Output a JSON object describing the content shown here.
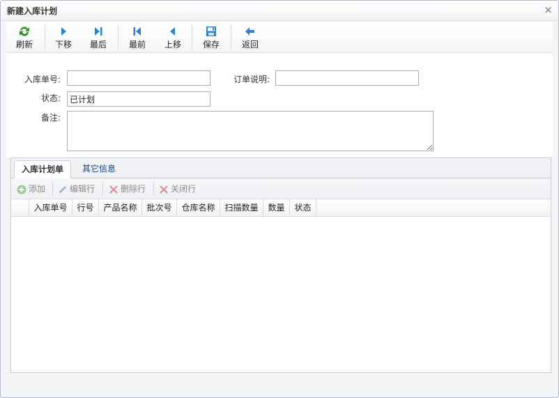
{
  "window": {
    "title": "新建入库计划",
    "close_symbol": "×"
  },
  "toolbar": {
    "refresh": "刷新",
    "next": "下移",
    "last": "最后",
    "first": "最前",
    "prev": "上移",
    "save": "保存",
    "back": "返回"
  },
  "form": {
    "order_no_label": "入库单号:",
    "order_no_value": "",
    "order_desc_label": "订单说明:",
    "order_desc_value": "",
    "status_label": "状态:",
    "status_value": "已计划",
    "remark_label": "备注:",
    "remark_value": ""
  },
  "tabs": [
    {
      "label": "入库计划单",
      "active": true
    },
    {
      "label": "其它信息",
      "active": false
    }
  ],
  "grid_toolbar": {
    "add": "添加",
    "edit": "编辑行",
    "delete": "删除行",
    "close": "关闭行"
  },
  "grid_columns": [
    "入库单号",
    "行号",
    "产品名称",
    "批次号",
    "仓库名称",
    "扫描数量",
    "数量",
    "状态"
  ],
  "grid_rows": [],
  "colors": {
    "accent": "#15428b",
    "refresh_icon": "#3aa132",
    "nav_icon": "#2f7fd6",
    "disabled_text": "#8a8a8a"
  }
}
